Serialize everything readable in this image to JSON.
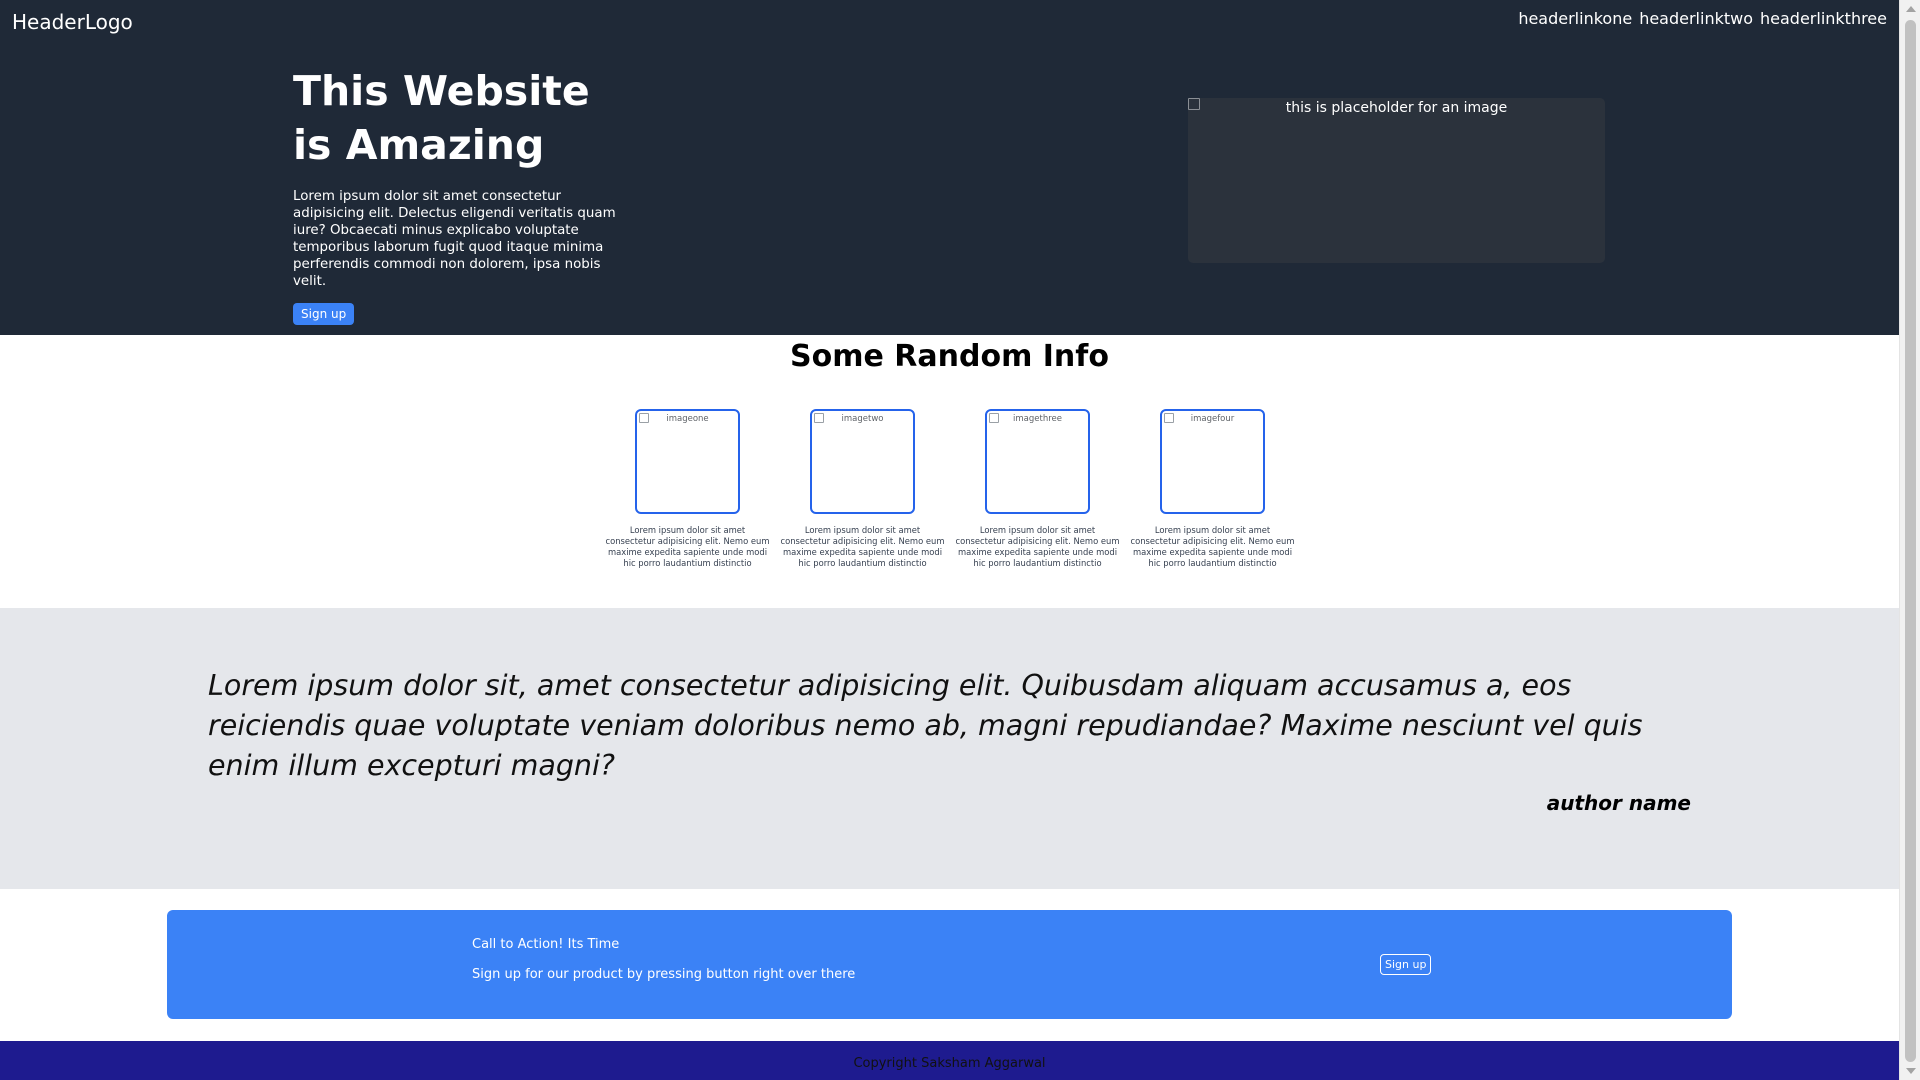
{
  "header": {
    "logo": "HeaderLogo",
    "links": [
      "headerlinkone",
      "headerlinktwo",
      "headerlinkthree"
    ]
  },
  "hero": {
    "title": "This Website is Amazing",
    "description": "Lorem ipsum dolor sit amet consectetur adipisicing elit. Delectus eligendi veritatis quam iure? Obcaecati minus explicabo voluptate temporibus laborum fugit quod itaque minima perferendis commodi non dolorem, ipsa nobis velit.",
    "signup_label": "Sign up",
    "image_alt": "this is placeholder for an image"
  },
  "info": {
    "title": "Some Random Info",
    "cards": [
      {
        "image_alt": "imageone",
        "text": "Lorem ipsum dolor sit amet consectetur adipisicing elit. Nemo eum maxime expedita sapiente unde modi hic porro laudantium distinctio"
      },
      {
        "image_alt": "imagetwo",
        "text": "Lorem ipsum dolor sit amet consectetur adipisicing elit. Nemo eum maxime expedita sapiente unde modi hic porro laudantium distinctio"
      },
      {
        "image_alt": "imagethree",
        "text": "Lorem ipsum dolor sit amet consectetur adipisicing elit. Nemo eum maxime expedita sapiente unde modi hic porro laudantium distinctio"
      },
      {
        "image_alt": "imagefour",
        "text": "Lorem ipsum dolor sit amet consectetur adipisicing elit. Nemo eum maxime expedita sapiente unde modi hic porro laudantium distinctio"
      }
    ]
  },
  "quote": {
    "text": "Lorem ipsum dolor sit, amet consectetur adipisicing elit. Quibusdam aliquam accusamus a, eos reiciendis quae voluptate veniam doloribus nemo ab, magni repudiandae? Maxime nesciunt vel quis enim illum excepturi magni?",
    "author": "author name"
  },
  "cta": {
    "title": "Call to Action! Its Time",
    "subtitle": "Sign up for our product by pressing button right over there",
    "button_label": "Sign up"
  },
  "footer": {
    "copyright": "Copyright Saksham Aggarwal"
  },
  "colors": {
    "hero_bg": "#1f2937",
    "accent": "#3b82f6",
    "quote_bg": "#e5e7eb",
    "footer_bg": "#1e1b8f"
  }
}
